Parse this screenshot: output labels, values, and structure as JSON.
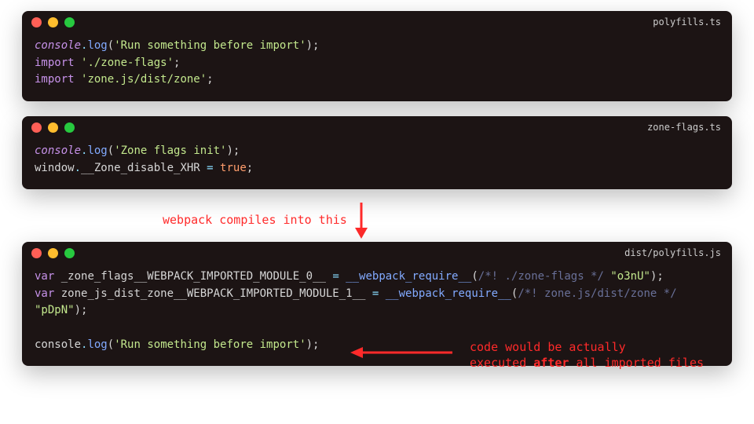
{
  "windows": {
    "w1": {
      "filename": "polyfills.ts",
      "line1": {
        "obj": "console",
        "dot": ".",
        "fn": "log",
        "open": "(",
        "str": "'Run something before import'",
        "close": ");"
      },
      "line2": {
        "kw": "import",
        "sp": " ",
        "str": "'./zone-flags'",
        "semi": ";"
      },
      "line3": {
        "kw": "import",
        "sp": " ",
        "str": "'zone.js/dist/zone'",
        "semi": ";"
      }
    },
    "w2": {
      "filename": "zone-flags.ts",
      "line1": {
        "obj": "console",
        "dot": ".",
        "fn": "log",
        "open": "(",
        "str": "'Zone flags init'",
        "close": ");"
      },
      "line2": {
        "a": "window",
        "b": ".",
        "c": "__Zone_disable_XHR",
        "d": " = ",
        "e": "true",
        "f": ";"
      }
    },
    "w3": {
      "filename": "dist/polyfills.js",
      "line1": {
        "a": "var",
        "b": " _zone_flags__WEBPACK_IMPORTED_MODULE_0__ ",
        "c": "=",
        "d": " __webpack_require__",
        "e": "(",
        "f": "/*! ./zone-flags */",
        "g": " ",
        "h": "\"o3nU\"",
        "i": ");"
      },
      "line2": {
        "a": "var",
        "b": " zone_js_dist_zone__WEBPACK_IMPORTED_MODULE_1__ ",
        "c": "=",
        "d": " __webpack_require__",
        "e": "(",
        "f": "/*! zone.js/dist/zone */",
        "g": " "
      },
      "line2b": {
        "a": "\"pDpN\"",
        "b": ");"
      },
      "line4": {
        "a": "console",
        "b": ".",
        "c": "log",
        "d": "(",
        "e": "'Run something before import'",
        "f": ");"
      }
    }
  },
  "annotations": {
    "compile": "webpack compiles into this",
    "note1": "code would be actually",
    "note2a": "executed ",
    "note2b": "after",
    "note2c": " all imported files"
  }
}
